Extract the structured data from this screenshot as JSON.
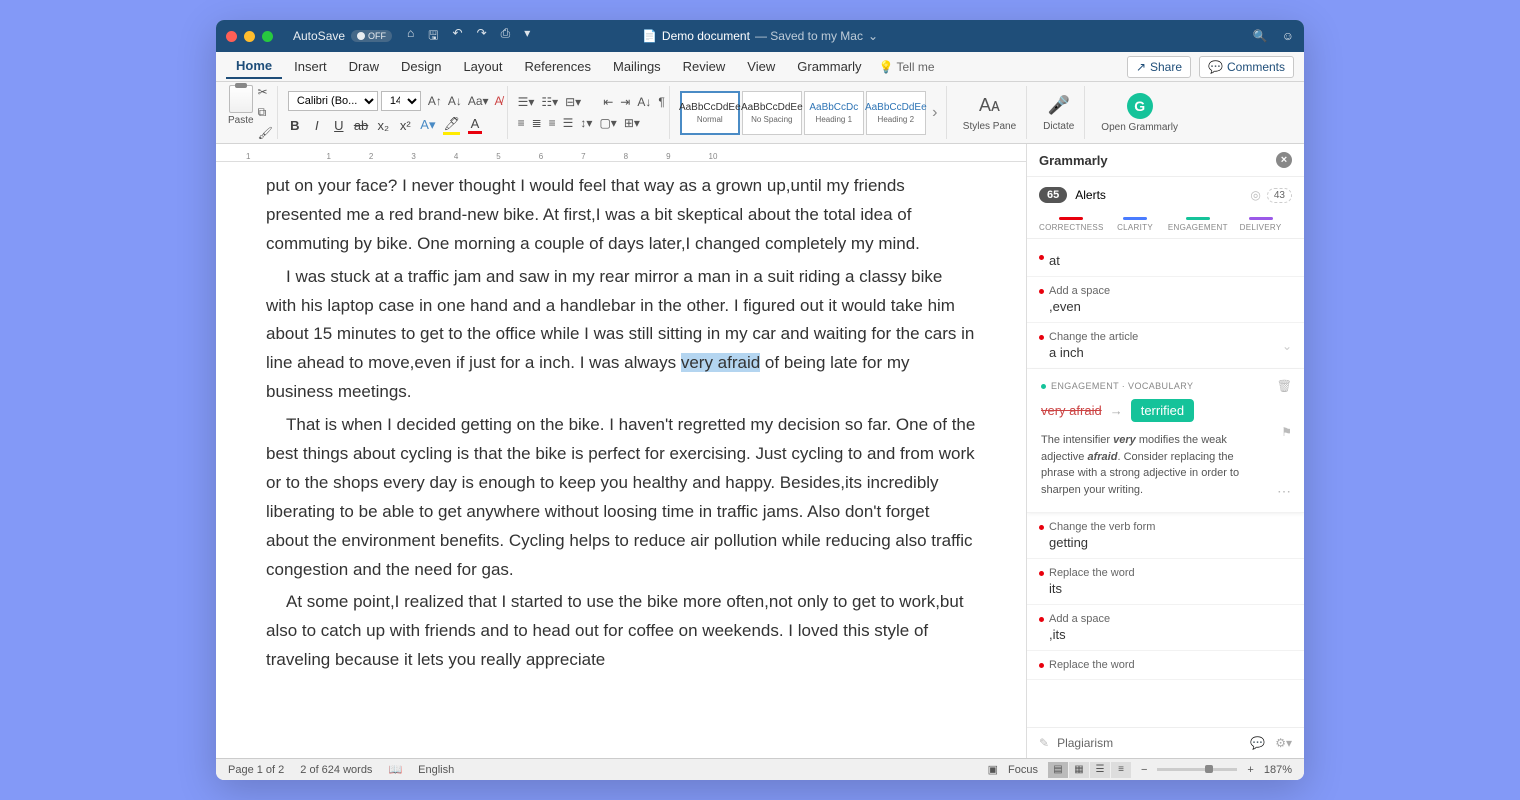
{
  "titlebar": {
    "autosave_label": "AutoSave",
    "autosave_state": "OFF",
    "doc_name": "Demo document",
    "doc_status": "— Saved to my Mac"
  },
  "menu": {
    "items": [
      "Home",
      "Insert",
      "Draw",
      "Design",
      "Layout",
      "References",
      "Mailings",
      "Review",
      "View",
      "Grammarly"
    ],
    "tellme": "Tell me",
    "share": "Share",
    "comments": "Comments"
  },
  "ribbon": {
    "paste": "Paste",
    "font_name": "Calibri (Bo...",
    "font_size": "14",
    "styles": [
      {
        "preview": "AaBbCcDdEe",
        "name": "Normal"
      },
      {
        "preview": "AaBbCcDdEe",
        "name": "No Spacing"
      },
      {
        "preview": "AaBbCcDc",
        "name": "Heading 1"
      },
      {
        "preview": "AaBbCcDdEe",
        "name": "Heading 2"
      }
    ],
    "styles_pane": "Styles Pane",
    "dictate": "Dictate",
    "open_grammarly": "Open Grammarly"
  },
  "ruler_marks": [
    "1",
    "",
    "1",
    "2",
    "3",
    "4",
    "5",
    "6",
    "7",
    "8",
    "9",
    "10"
  ],
  "document": {
    "p1a": "put on your face? I never thought I would feel that way as a grown up,until my friends presented me a red brand-new bike. At first,I was a bit skeptical about the total idea of commuting by bike. One morning a couple of days later,I changed completely my mind.",
    "p2a": "I was stuck at a traffic jam and saw in my rear mirror a man in a suit riding a classy bike with his laptop case in one hand and a handlebar in the other. I figured out it would take him about 15 minutes to get to the office while I was still sitting in my car and waiting for the cars in line ahead to move,even if just for a inch. I was always ",
    "p2_highlight": "very afraid",
    "p2b": " of being late for my business meetings.",
    "p3": "That is when I decided getting on the bike. I haven't regretted my decision so far. One of the best things about cycling is that the bike is perfect for exercising. Just cycling to and from work or to the shops every day is enough to keep you healthy and happy. Besides,its incredibly liberating to be able to get anywhere without loosing time in traffic jams. Also don't forget about the environment benefits. Cycling helps to reduce air pollution while reducing also traffic congestion and the need for gas.",
    "p4": "At some point,I realized that I started to use the bike more often,not only to get to work,but also to catch up with friends and to head out for coffee on weekends. I loved this style of traveling because it lets you really appreciate"
  },
  "grammarly": {
    "header": "Grammarly",
    "alerts_count": "65",
    "alerts_label": "Alerts",
    "score": "43",
    "tabs": {
      "correctness": "CORRECTNESS",
      "clarity": "CLARITY",
      "engagement": "ENGAGEMENT",
      "delivery": "DELIVERY"
    },
    "cards": [
      {
        "title": "",
        "word": "at"
      },
      {
        "title": "Add a space",
        "word": ",even"
      },
      {
        "title": "Change the article",
        "word": "a inch"
      }
    ],
    "expanded": {
      "category": "ENGAGEMENT · VOCABULARY",
      "from": "very afraid",
      "to": "terrified",
      "desc_pre": "The intensifier ",
      "desc_em1": "very",
      "desc_mid1": " modifies the weak adjective ",
      "desc_em2": "afraid",
      "desc_post": ". Consider replacing the phrase with a strong adjective in order to sharpen your writing."
    },
    "cards2": [
      {
        "title": "Change the verb form",
        "word": "getting"
      },
      {
        "title": "Replace the word",
        "word": "its"
      },
      {
        "title": "Add a space",
        "word": ",its"
      },
      {
        "title": "Replace the word",
        "word": ""
      }
    ],
    "footer": "Plagiarism"
  },
  "status": {
    "page": "Page 1 of 2",
    "words": "2 of 624 words",
    "lang": "English",
    "focus": "Focus",
    "zoom": "187%"
  }
}
